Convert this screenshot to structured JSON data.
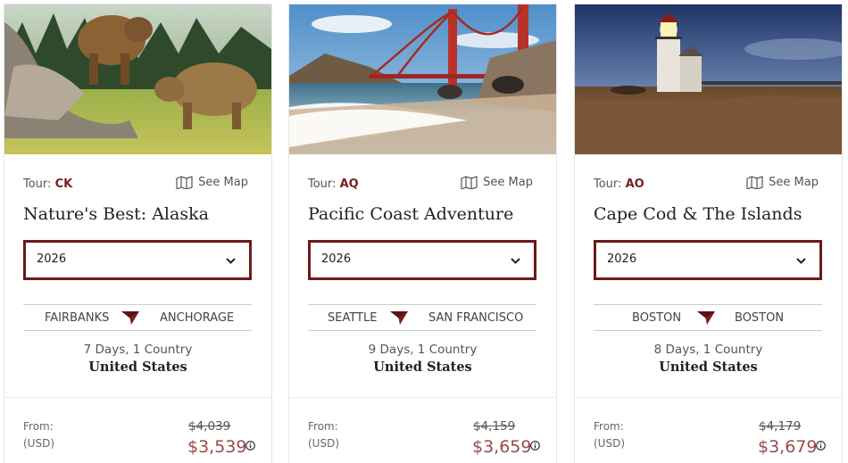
{
  "cards": [
    {
      "photo": "bears-in-meadow",
      "tour_prefix": "Tour:",
      "tour_code": "CK",
      "see_map": "See Map",
      "title": "Nature's Best: Alaska",
      "year": "2026",
      "route_from": "FAIRBANKS",
      "route_to": "ANCHORAGE",
      "duration": "7 Days, 1 Country",
      "country": "United States",
      "from_label": "From:",
      "currency": "(USD)",
      "old_price": "$4,039",
      "price": "$3,539"
    },
    {
      "photo": "golden-gate-bridge-beach",
      "tour_prefix": "Tour:",
      "tour_code": "AQ",
      "see_map": "See Map",
      "title": "Pacific Coast Adventure",
      "year": "2026",
      "route_from": "SEATTLE",
      "route_to": "SAN FRANCISCO",
      "duration": "9 Days, 1 Country",
      "country": "United States",
      "from_label": "From:",
      "currency": "(USD)",
      "old_price": "$4,159",
      "price": "$3,659"
    },
    {
      "photo": "lighthouse-at-dusk",
      "tour_prefix": "Tour:",
      "tour_code": "AO",
      "see_map": "See Map",
      "title": "Cape Cod & The Islands",
      "year": "2026",
      "route_from": "BOSTON",
      "route_to": "BOSTON",
      "duration": "8 Days, 1 Country",
      "country": "United States",
      "from_label": "From:",
      "currency": "(USD)",
      "old_price": "$4,179",
      "price": "$3,679"
    }
  ],
  "colors": {
    "accent": "#6b1a1a",
    "tour_code": "#7a1f1f",
    "price": "#9a4a4a"
  },
  "icons": [
    "map-icon",
    "chevron-down-icon",
    "route-arrow-icon",
    "info-icon"
  ]
}
